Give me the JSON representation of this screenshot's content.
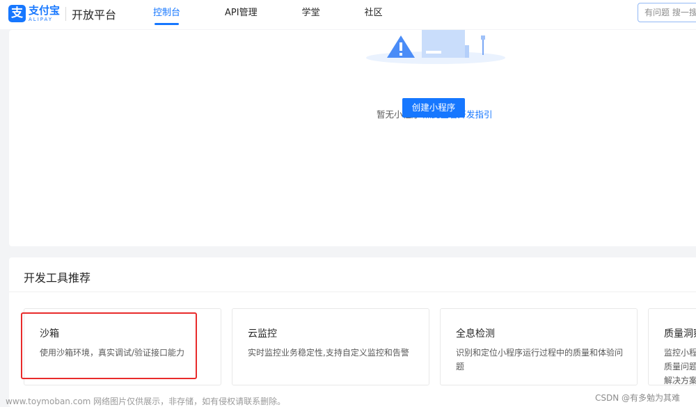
{
  "header": {
    "logo_cn": "支付宝",
    "logo_en": "ALIPAY",
    "logo_glyph": "支",
    "title": "开放平台",
    "nav": [
      "控制台",
      "API管理",
      "学堂",
      "社区"
    ],
    "active_nav": "控制台",
    "search_placeholder": "有问题 搜一搜"
  },
  "empty_state": {
    "text": "暂无小程序",
    "link": "点此查看开发指引",
    "button": "创建小程序"
  },
  "tools": {
    "title": "开发工具推荐",
    "cards": [
      {
        "name": "沙箱",
        "desc": "使用沙箱环境，真实调试/验证接口能力"
      },
      {
        "name": "云监控",
        "desc": "实时监控业务稳定性,支持自定义监控和告警"
      },
      {
        "name": "全息检测",
        "desc": "识别和定位小程序运行过程中的质量和体验问题"
      },
      {
        "name": "质量洞察",
        "desc": "监控小程序质量问题和解决方案"
      }
    ]
  },
  "watermarks": {
    "left": "www.toymoban.com 网络图片仅供展示，非存储，如有侵权请联系删除。",
    "right": "CSDN @有多勉为其难"
  },
  "colors": {
    "brand": "#1677ff",
    "highlight": "#e82a2a"
  }
}
